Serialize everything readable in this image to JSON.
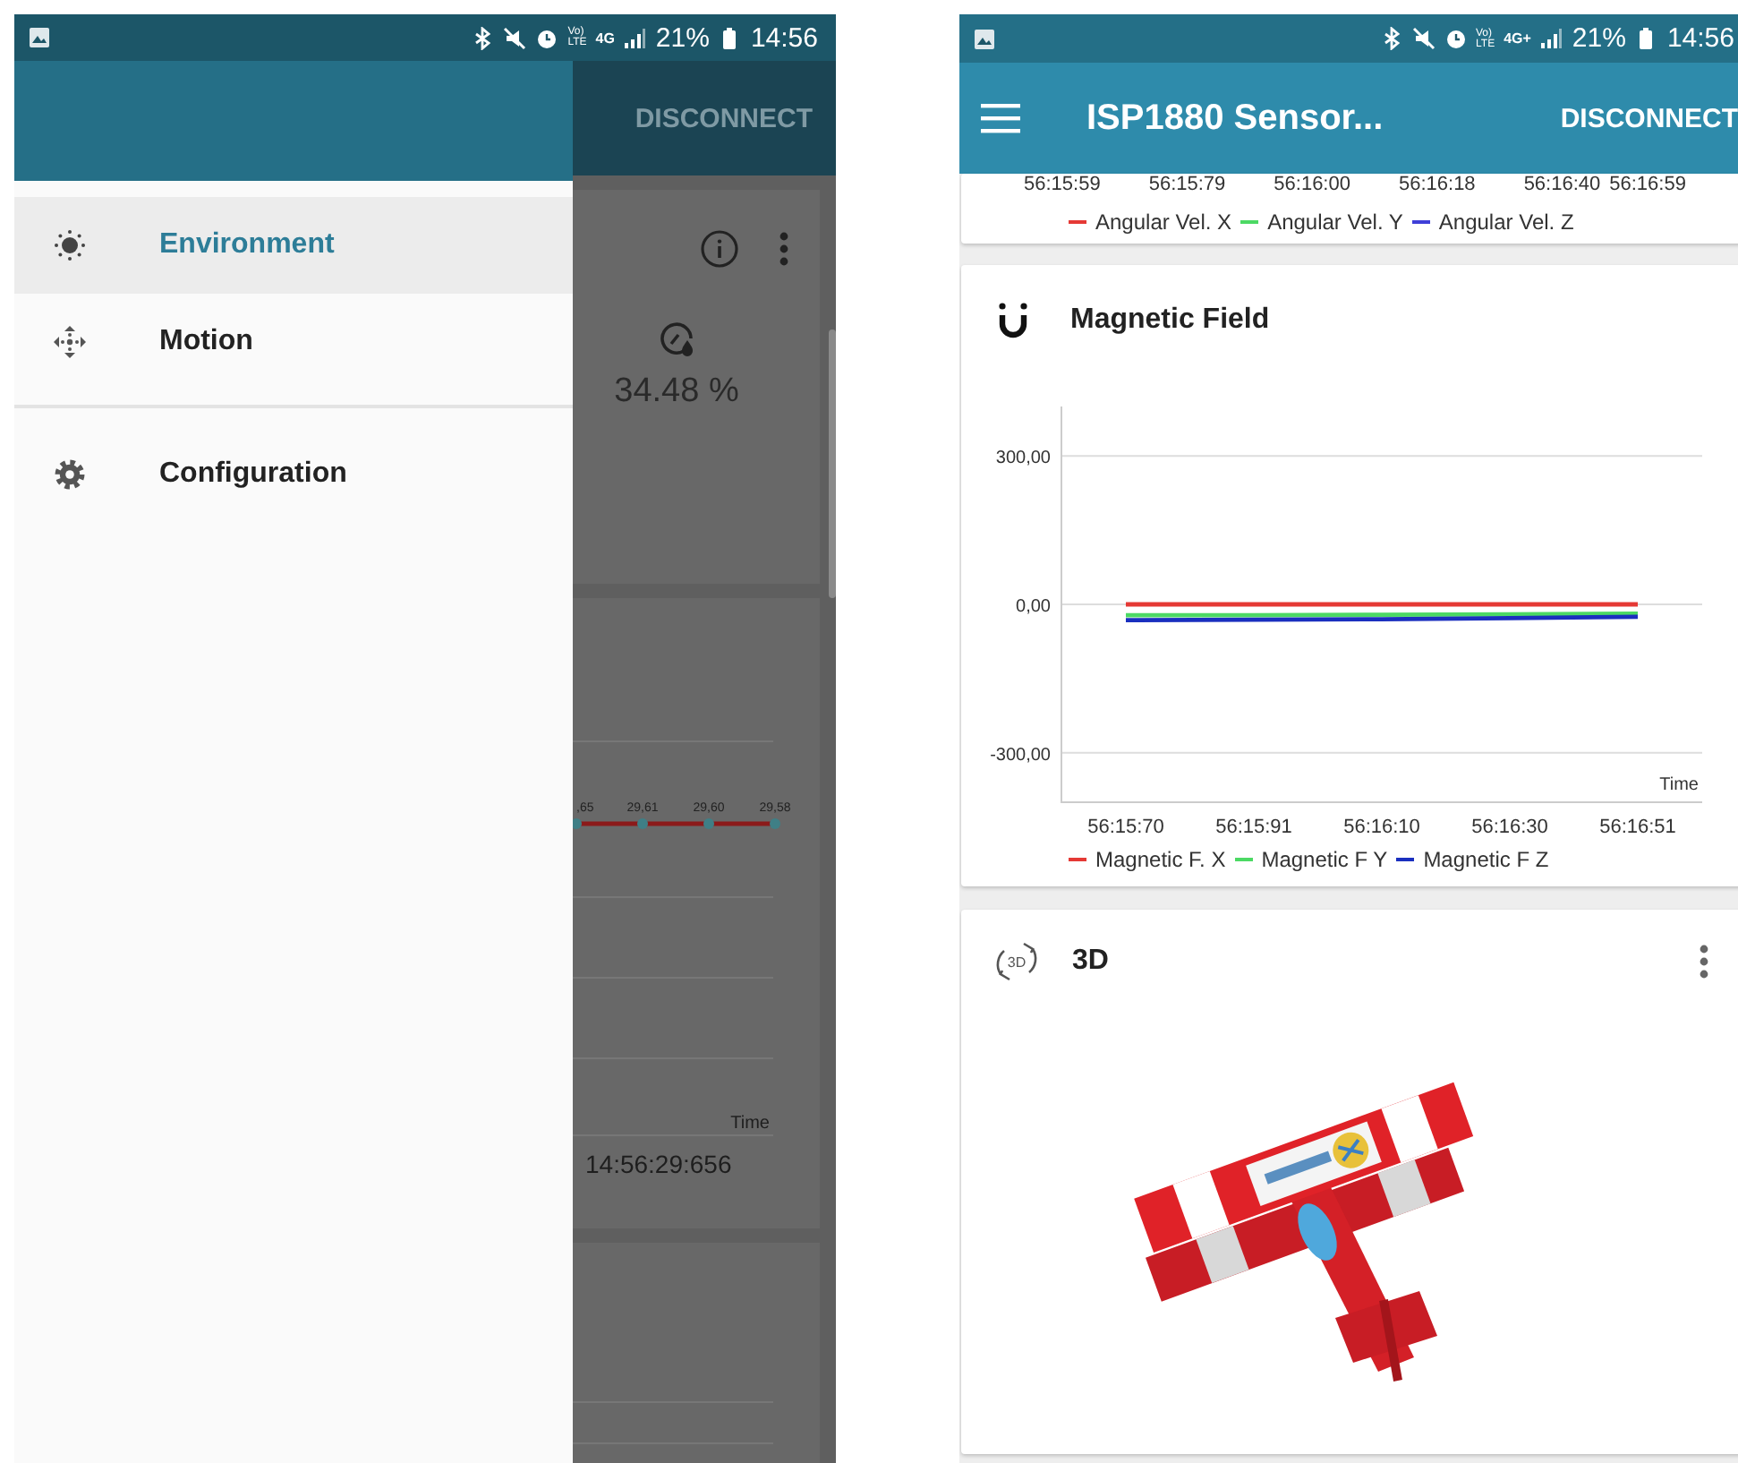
{
  "left_screen": {
    "status_bar": {
      "volte": [
        "Vo)",
        "LTE"
      ],
      "network": "4G",
      "battery": "21%",
      "time": "14:56"
    },
    "drawer": {
      "sections": [
        [
          {
            "label": "Environment",
            "selected": true
          },
          {
            "label": "Motion",
            "selected": false
          }
        ],
        [
          {
            "label": "Configuration",
            "selected": false
          }
        ]
      ]
    },
    "app_bar": {
      "action": "DISCONNECT"
    },
    "humidity_card": {
      "reading": "34.48 %"
    },
    "chart_card": {
      "point_labels": [
        ",65",
        "29,61",
        "29,60",
        "29,58"
      ],
      "axis_label": "Time",
      "time": "14:56:29:656"
    }
  },
  "right_screen": {
    "status_bar": {
      "volte": [
        "Vo)",
        "LTE"
      ],
      "network": "4G+",
      "battery": "21%",
      "time": "14:56"
    },
    "app_bar": {
      "title": "ISP1880 Sensor...",
      "action": "DISCONNECT"
    },
    "angular_card": {
      "x_labels": [
        "56:15:59",
        "56:15:79",
        "56:16:00",
        "56:16:18",
        "56:16:40",
        "56:16:59"
      ],
      "legend": [
        {
          "name": "Angular Vel. X",
          "color": "#e53935"
        },
        {
          "name": "Angular Vel. Y",
          "color": "#4cd964"
        },
        {
          "name": "Angular Vel. Z",
          "color": "#3f3fd8"
        }
      ]
    },
    "magnetic_card": {
      "title": "Magnetic Field",
      "chart_data": {
        "type": "line",
        "xlabel": "Time",
        "categories": [
          "56:15:70",
          "56:15:91",
          "56:16:10",
          "56:16:30",
          "56:16:51"
        ],
        "ylim": [
          -400,
          400
        ],
        "grid": true,
        "yticks": [
          {
            "value": 300,
            "label": "300,00"
          },
          {
            "value": 0,
            "label": "0,00"
          },
          {
            "value": -300,
            "label": "-300,00"
          }
        ],
        "series": [
          {
            "name": "Magnetic F. X",
            "color": "#e53935",
            "values": [
              0,
              0,
              0,
              0,
              0
            ]
          },
          {
            "name": "Magnetic F Y",
            "color": "#4cd964",
            "values": [
              -22,
              -22,
              -21,
              -20,
              -19
            ]
          },
          {
            "name": "Magnetic F Z",
            "color": "#1a2fbf",
            "values": [
              -32,
              -31,
              -30,
              -28,
              -25
            ]
          }
        ]
      }
    },
    "model_card": {
      "icon_label": "3D",
      "title": "3D"
    }
  }
}
